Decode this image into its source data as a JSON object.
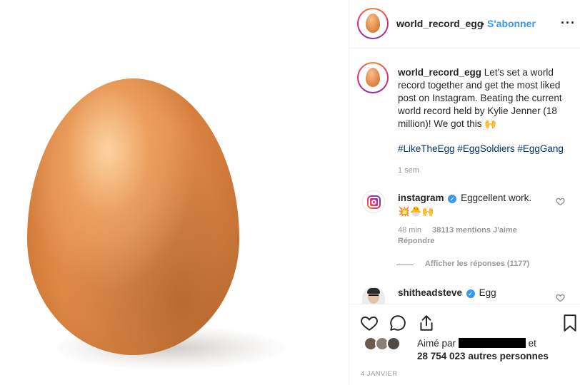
{
  "post": {
    "username": "world_record_egg",
    "separator": "•",
    "follow_label": "S'abonner",
    "more_label": "···"
  },
  "caption": {
    "username": "world_record_egg",
    "text": "Let's set a world record together and get the most liked post on Instagram. Beating the current world record held by Kylie Jenner (18 million)! We got this 🙌",
    "hashtags": "#LikeTheEgg #EggSoldiers #EggGang",
    "time": "1 sem"
  },
  "comments": [
    {
      "username": "instagram",
      "verified": true,
      "text": "Eggcellent work.",
      "emoji_line": "💥🐣🙌",
      "time": "48 min",
      "likes": "38113 mentions J'aime",
      "reply_label": "Répondre",
      "view_replies": "Afficher les réponses (1177)"
    },
    {
      "username": "shitheadsteve",
      "verified": true,
      "text": "Egg"
    }
  ],
  "likes": {
    "prefix": "Aimé par",
    "suffix": "et",
    "others": "28 754 023 autres personnes"
  },
  "date": "4 JANVIER",
  "colors": {
    "accent": "#3897f0",
    "hashtag": "#003569",
    "muted": "#999999",
    "text": "#262626",
    "egg": "#de8846"
  }
}
